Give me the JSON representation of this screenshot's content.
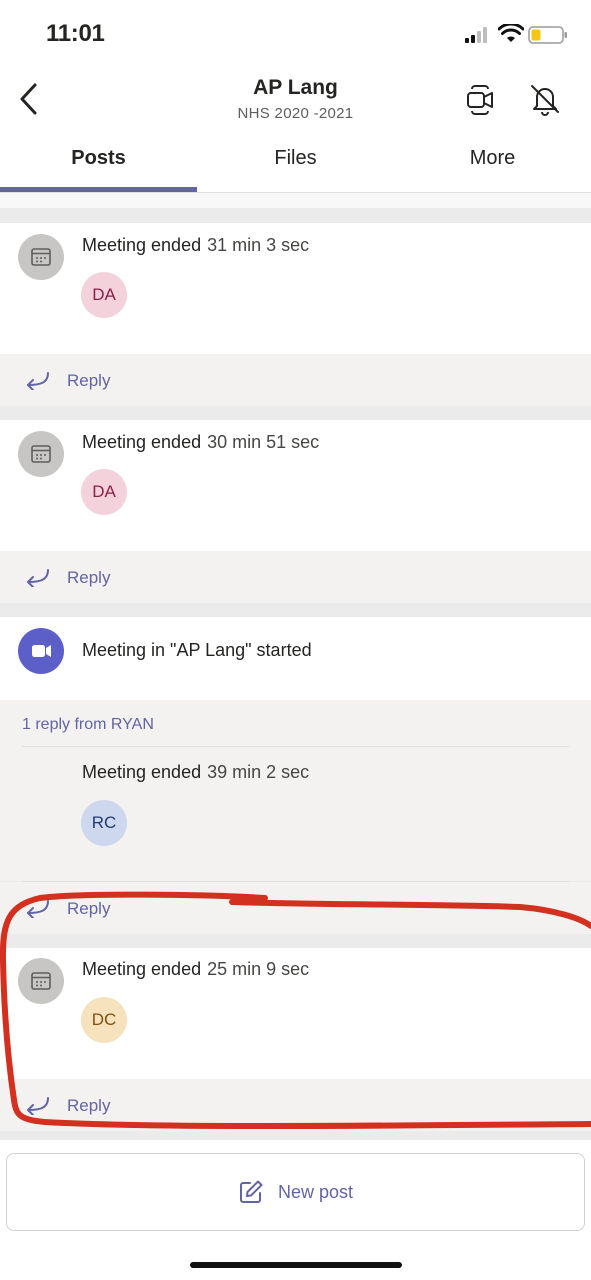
{
  "status_bar": {
    "time": "11:01"
  },
  "header": {
    "title": "AP Lang",
    "subtitle": "NHS 2020 -2021"
  },
  "tabs": [
    {
      "label": "Posts",
      "active": true
    },
    {
      "label": "Files",
      "active": false
    },
    {
      "label": "More",
      "active": false
    }
  ],
  "posts": [
    {
      "text": "Meeting ended",
      "duration": "31 min 3 sec",
      "avatar": "DA",
      "reply_label": "Reply"
    },
    {
      "text": "Meeting ended",
      "duration": "30 min 51 sec",
      "avatar": "DA",
      "reply_label": "Reply"
    },
    {
      "text": "Meeting in \"AP Lang\" started",
      "thread_link": "1 reply from RYAN",
      "reply": {
        "text": "Meeting ended",
        "duration": "39 min 2 sec",
        "avatar": "RC"
      },
      "reply_label": "Reply"
    },
    {
      "text": "Meeting ended",
      "duration": "25 min 9 sec",
      "avatar": "DC",
      "reply_label": "Reply"
    }
  ],
  "new_post_label": "New post",
  "colors": {
    "accent": "#6264a7",
    "annotation_red": "#d4301f",
    "avatar_da": "#f4d2dc",
    "avatar_rc": "#cdd7ee",
    "avatar_dc": "#f6e3bd"
  }
}
